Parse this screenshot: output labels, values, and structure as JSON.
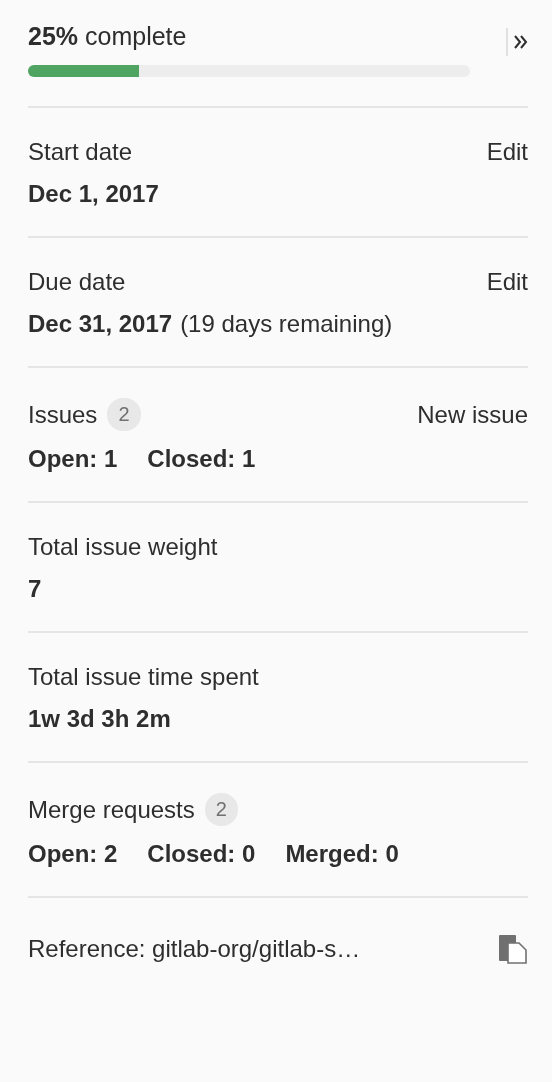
{
  "progress": {
    "percent": "25%",
    "label": "complete",
    "level": 0.25
  },
  "sections": [
    {
      "kind": "date",
      "title": "Start date",
      "action": "Edit",
      "value": "Dec 1, 2017"
    },
    {
      "kind": "date",
      "title": "Due date",
      "action": "Edit",
      "value": "Dec 31, 2017",
      "note": "(19 days remaining)"
    },
    {
      "kind": "counts",
      "title": "Issues",
      "count": "2",
      "action": "New issue",
      "stats": [
        "Open: 1",
        "Closed: 1"
      ]
    },
    {
      "kind": "value",
      "title": "Total issue weight",
      "value": "7"
    },
    {
      "kind": "value",
      "title": "Total issue time spent",
      "value": "1w 3d 3h 2m"
    },
    {
      "kind": "counts",
      "title": "Merge requests",
      "count": "2",
      "stats": [
        "Open: 2",
        "Closed: 0",
        "Merged: 0"
      ]
    },
    {
      "kind": "reference",
      "text": "Reference: gitlab-org/gitlab-s…"
    }
  ]
}
